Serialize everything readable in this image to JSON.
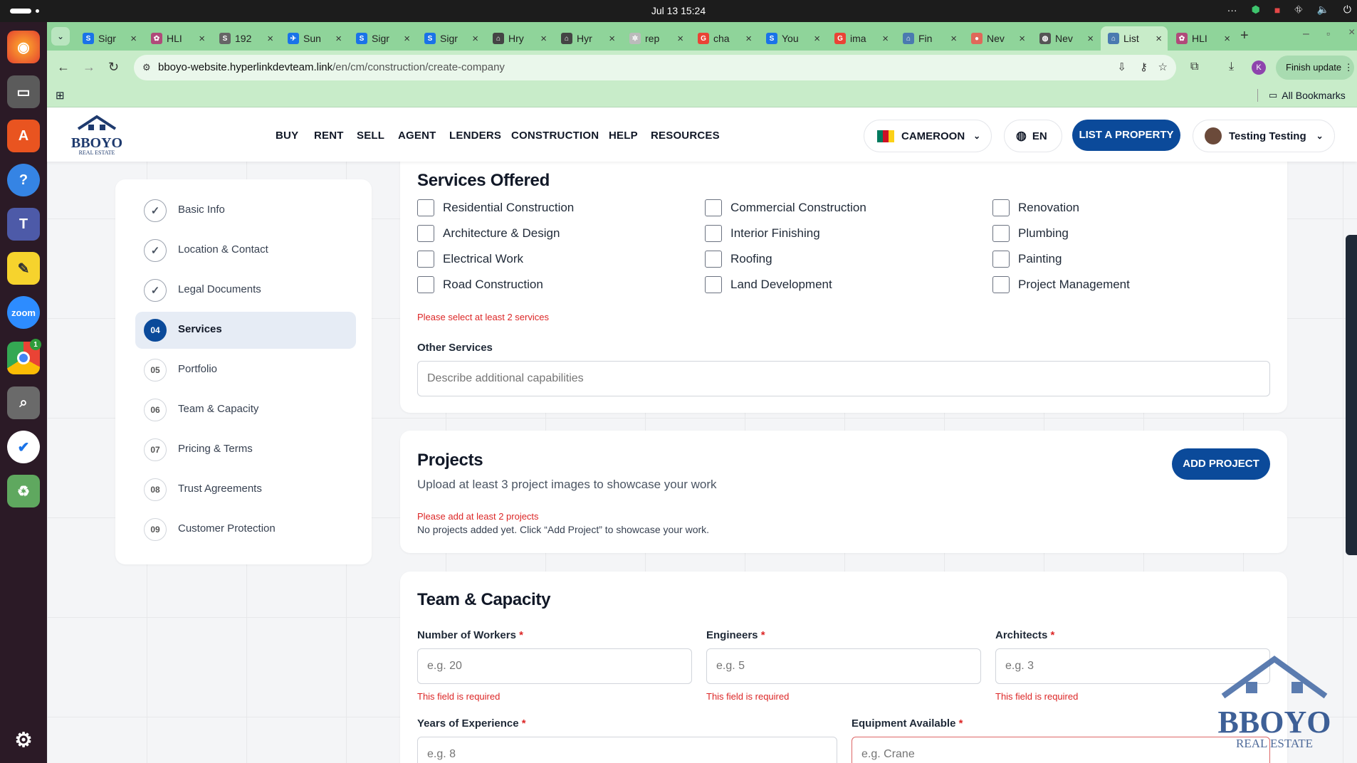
{
  "os": {
    "clock": "Jul 13  15:24",
    "tray_dots": "···"
  },
  "browser": {
    "tabs": [
      {
        "label": "Sigr",
        "fav": "S",
        "color": "#1a73e8"
      },
      {
        "label": "HLI",
        "fav": "✿",
        "color": "#b04a7a"
      },
      {
        "label": "192",
        "fav": "S",
        "color": "#666666"
      },
      {
        "label": "Sun",
        "fav": "✈",
        "color": "#1a73e8"
      },
      {
        "label": "Sigr",
        "fav": "S",
        "color": "#1a73e8"
      },
      {
        "label": "Sigr",
        "fav": "S",
        "color": "#1a73e8"
      },
      {
        "label": "Hry",
        "fav": "⌂",
        "color": "#444444"
      },
      {
        "label": "Hyr",
        "fav": "⌂",
        "color": "#444444"
      },
      {
        "label": "rep",
        "fav": "✲",
        "color": "#bbbbbb"
      },
      {
        "label": "cha",
        "fav": "G",
        "color": "#ea4335"
      },
      {
        "label": "You",
        "fav": "S",
        "color": "#1a73e8"
      },
      {
        "label": "ima",
        "fav": "G",
        "color": "#ea4335"
      },
      {
        "label": "Fin",
        "fav": "⌂",
        "color": "#4a7ab0"
      },
      {
        "label": "Nev",
        "fav": "●",
        "color": "#e0685a"
      },
      {
        "label": "Nev",
        "fav": "◍",
        "color": "#555555"
      },
      {
        "label": "List",
        "fav": "⌂",
        "color": "#4a7ab0"
      },
      {
        "label": "HLI",
        "fav": "✿",
        "color": "#b04a7a"
      }
    ],
    "url_host": "bboyo-website.hyperlinkdevteam.link",
    "url_path": "/en/cm/construction/create-company",
    "finish_update": "Finish update",
    "profile_initial": "K",
    "bookmarks_label": "All Bookmarks"
  },
  "header": {
    "logo_text": "BBOYO",
    "logo_sub": "REAL ESTATE",
    "nav": [
      "BUY",
      "RENT",
      "SELL",
      "AGENT",
      "LENDERS",
      "CONSTRUCTION",
      "HELP",
      "RESOURCES"
    ],
    "country": "CAMEROON",
    "language": "EN",
    "list_property": "LIST A PROPERTY",
    "user_name": "Testing Testing"
  },
  "steps": [
    {
      "num": "✓",
      "label": "Basic Info",
      "state": "done"
    },
    {
      "num": "✓",
      "label": "Location & Contact",
      "state": "done"
    },
    {
      "num": "✓",
      "label": "Legal Documents",
      "state": "done"
    },
    {
      "num": "04",
      "label": "Services",
      "state": "current"
    },
    {
      "num": "05",
      "label": "Portfolio",
      "state": "todo"
    },
    {
      "num": "06",
      "label": "Team & Capacity",
      "state": "todo"
    },
    {
      "num": "07",
      "label": "Pricing & Terms",
      "state": "todo"
    },
    {
      "num": "08",
      "label": "Trust Agreements",
      "state": "todo"
    },
    {
      "num": "09",
      "label": "Customer Protection",
      "state": "todo"
    }
  ],
  "services": {
    "title": "Services Offered",
    "options": [
      [
        "Residential Construction",
        "Commercial Construction",
        "Renovation"
      ],
      [
        "Architecture & Design",
        "Interior Finishing",
        "Plumbing"
      ],
      [
        "Electrical Work",
        "Roofing",
        "Painting"
      ],
      [
        "Road Construction",
        "Land Development",
        "Project Management"
      ]
    ],
    "error": "Please select at least 2 services",
    "other_label": "Other Services",
    "other_placeholder": "Describe additional capabilities"
  },
  "projects": {
    "title": "Projects",
    "subtitle": "Upload at least 3 project images to showcase your work",
    "add_button": "ADD PROJECT",
    "error": "Please add at least 2 projects",
    "empty": "No projects added yet. Click “Add Project” to showcase your work."
  },
  "team": {
    "title": "Team & Capacity",
    "required_mark": "*",
    "fields": [
      {
        "label": "Number of Workers",
        "placeholder": "e.g. 20",
        "error": "This field is required"
      },
      {
        "label": "Engineers",
        "placeholder": "e.g. 5",
        "error": "This field is required"
      },
      {
        "label": "Architects",
        "placeholder": "e.g. 3",
        "error": "This field is required"
      }
    ],
    "years_label": "Years of Experience",
    "years_placeholder": "e.g. 8",
    "equipment_label": "Equipment Available",
    "equipment_placeholder": "e.g. Crane"
  },
  "watermark": {
    "text": "BBOYO",
    "sub": "REAL ESTATE"
  },
  "colors": {
    "brand": "#0b4a9a",
    "error": "#dc2626",
    "browser_green": "#8fd49a"
  }
}
